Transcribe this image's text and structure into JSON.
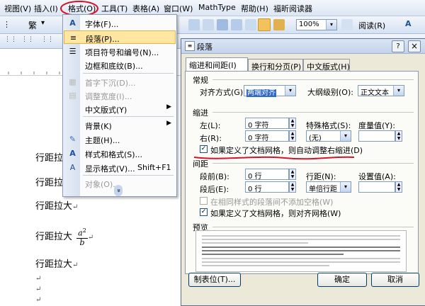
{
  "menubar": {
    "items": [
      "视图(V)",
      "插入(I)",
      "格式(O)",
      "工具(T)",
      "表格(A)",
      "窗口(W)",
      "MathType",
      "帮助(H)",
      "福昕阅读器"
    ]
  },
  "toolbar": {
    "zoom": "100%",
    "read_label": "阅读(R)",
    "style_label": "繁",
    "font_size_label": "A"
  },
  "format_menu": {
    "items": [
      {
        "label": "字体(F)...",
        "icon": "font-icon",
        "enabled": true
      },
      {
        "label": "段落(P)...",
        "icon": "paragraph-icon",
        "enabled": true,
        "highlighted": true
      },
      {
        "label": "项目符号和编号(N)...",
        "icon": "bullets-icon",
        "enabled": true
      },
      {
        "label": "边框和底纹(B)...",
        "icon": "",
        "enabled": true
      },
      {
        "label": "首字下沉(D)...",
        "icon": "dropcap-icon",
        "enabled": false
      },
      {
        "label": "调整宽度(I)...",
        "icon": "width-icon",
        "enabled": false
      },
      {
        "label": "中文版式(Y)",
        "icon": "",
        "enabled": true,
        "submenu": true
      },
      {
        "label": "背景(K)",
        "icon": "",
        "enabled": true,
        "submenu": true
      },
      {
        "label": "主题(H)...",
        "icon": "theme-icon",
        "enabled": true
      },
      {
        "label": "样式和格式(S)...",
        "icon": "styles-icon",
        "enabled": true
      },
      {
        "label": "显示格式(V)...",
        "icon": "reveal-format-icon",
        "enabled": true,
        "shortcut": "Shift+F1"
      },
      {
        "label": "对象(O)...",
        "icon": "",
        "enabled": false
      }
    ],
    "more_label": "»"
  },
  "document": {
    "lines": [
      "行距拉大",
      "行距拉大",
      "行距拉大",
      "行距拉大",
      "行距拉大"
    ],
    "fraction_num": "a",
    "fraction_exp": "2",
    "fraction_den": "b",
    "para_mark": "↵"
  },
  "dialog": {
    "title": "段落",
    "tabs": [
      "缩进和间距(I)",
      "换行和分页(P)",
      "中文版式(H)"
    ],
    "general": {
      "heading": "常规",
      "align_label": "对齐方式(G):",
      "align_value": "两端对齐",
      "outline_label": "大纲级别(O):",
      "outline_value": "正文文本"
    },
    "indent": {
      "heading": "缩进",
      "left_label": "左(L):",
      "left_value": "0 字符",
      "right_label": "右(R):",
      "right_value": "0 字符",
      "special_label": "特殊格式(S):",
      "special_value": "(无)",
      "by_label": "度量值(Y):",
      "by_value": "",
      "grid_check": "如果定义了文档网格，则自动调整右缩进(D)",
      "grid_checked": true
    },
    "spacing": {
      "heading": "间距",
      "before_label": "段前(B):",
      "before_value": "0 行",
      "after_label": "段后(E):",
      "after_value": "0 行",
      "line_label": "行距(N):",
      "line_value": "单倍行距",
      "at_label": "设置值(A):",
      "at_value": "",
      "no_space_check": "在相同样式的段落间不添加空格(W)",
      "no_space_checked": false,
      "snap_check": "如果定义了文档网格，则对齐网格(W)",
      "snap_checked": true
    },
    "preview_label": "预览",
    "tabs_button": "制表位(T)...",
    "ok_button": "确定",
    "cancel_button": "取消",
    "help_icon": "?",
    "close_icon": "×"
  },
  "colors": {
    "annotation_red": "#d3142a",
    "menu_highlight": "#ffe7a2",
    "selected_text_bg": "#316ac5"
  }
}
